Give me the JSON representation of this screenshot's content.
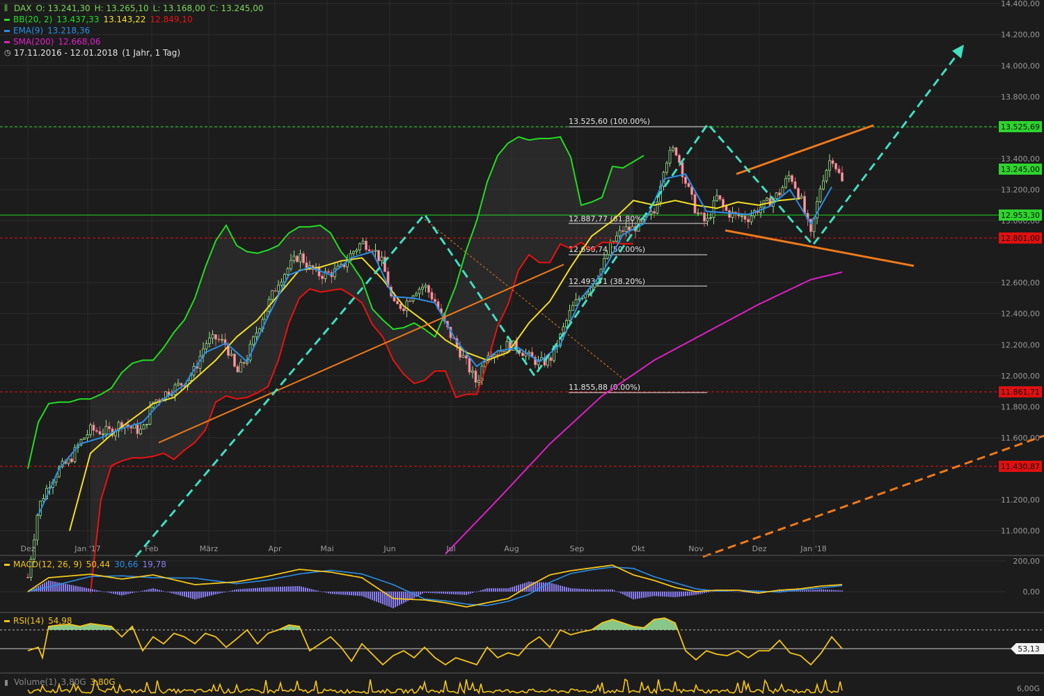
{
  "legend": {
    "dax": {
      "name": "DAX",
      "o": "O: 13.241,30",
      "h": "H: 13.265,10",
      "l": "L: 13.168,00",
      "c": "C: 13.245,00",
      "color": "#7ed957"
    },
    "bb": {
      "name": "BB(20, 2)",
      "upper": "13.437,33",
      "mid": "13.143,22",
      "lower": "12.849,10",
      "colors": {
        "upper": "#22dd22",
        "mid": "#f5e024",
        "lower": "#ee1111"
      }
    },
    "ema": {
      "name": "EMA(9)",
      "value": "13.218,36",
      "color": "#2a8fe8"
    },
    "sma": {
      "name": "SMA(200)",
      "value": "12.668,06",
      "color": "#e020c8"
    },
    "range": "17.11.2016 - 12.01.2018",
    "period": "(1 Jahr, 1 Tag)"
  },
  "macd": {
    "label": "MACD(12, 26, 9)",
    "v1": "50,44",
    "v2": "30,66",
    "v3": "19,78"
  },
  "rsi": {
    "label": "RSI(14)",
    "value": "54,98",
    "marker": "53,13"
  },
  "volume": {
    "label": "Volume(1)",
    "v1": "3,80G",
    "v2": "3,80G",
    "axis_top": "6,00G"
  },
  "chart_data": {
    "type": "candlestick",
    "title": "DAX",
    "x_tick_labels": [
      "Dez",
      "Jan '17",
      "Feb",
      "März",
      "Apr",
      "Mai",
      "Jun",
      "Jul",
      "Aug",
      "Sep",
      "Okt",
      "Nov",
      "Dez",
      "Jan '18"
    ],
    "y_range": [
      10850,
      14450
    ],
    "y_tick_labels": [
      "11.000,00",
      "11.200,00",
      "11.600,00",
      "11.800,00",
      "12.000,00",
      "12.200,00",
      "12.400,00",
      "12.600,00",
      "13.000,00",
      "13.200,00",
      "13.400,00",
      "13.600,00",
      "13.800,00",
      "14.000,00",
      "14.200,00",
      "14.400,00"
    ],
    "price_path": [
      [
        0,
        10700
      ],
      [
        10,
        11150
      ],
      [
        20,
        11300
      ],
      [
        30,
        11400
      ],
      [
        40,
        11450
      ],
      [
        50,
        11570
      ],
      [
        60,
        11650
      ],
      [
        70,
        11640
      ],
      [
        80,
        11640
      ],
      [
        90,
        11700
      ],
      [
        100,
        11660
      ],
      [
        110,
        11640
      ],
      [
        120,
        11830
      ],
      [
        130,
        11880
      ],
      [
        140,
        11920
      ],
      [
        150,
        11960
      ],
      [
        160,
        12040
      ],
      [
        170,
        12210
      ],
      [
        180,
        12240
      ],
      [
        190,
        12200
      ],
      [
        200,
        12010
      ],
      [
        210,
        12120
      ],
      [
        220,
        12300
      ],
      [
        230,
        12460
      ],
      [
        240,
        12610
      ],
      [
        250,
        12700
      ],
      [
        260,
        12780
      ],
      [
        270,
        12690
      ],
      [
        280,
        12650
      ],
      [
        290,
        12660
      ],
      [
        300,
        12690
      ],
      [
        310,
        12790
      ],
      [
        320,
        12860
      ],
      [
        330,
        12830
      ],
      [
        340,
        12720
      ],
      [
        350,
        12450
      ],
      [
        360,
        12450
      ],
      [
        370,
        12550
      ],
      [
        380,
        12580
      ],
      [
        390,
        12480
      ],
      [
        400,
        12320
      ],
      [
        410,
        12200
      ],
      [
        420,
        12080
      ],
      [
        430,
        11950
      ],
      [
        440,
        12160
      ],
      [
        450,
        12150
      ],
      [
        460,
        12200
      ],
      [
        470,
        12180
      ],
      [
        480,
        12120
      ],
      [
        490,
        12080
      ],
      [
        500,
        12100
      ],
      [
        510,
        12250
      ],
      [
        520,
        12420
      ],
      [
        530,
        12520
      ],
      [
        540,
        12580
      ],
      [
        550,
        12700
      ],
      [
        560,
        12860
      ],
      [
        570,
        12940
      ],
      [
        580,
        12950
      ],
      [
        590,
        13000
      ],
      [
        600,
        13050
      ],
      [
        610,
        13380
      ],
      [
        620,
        13470
      ],
      [
        630,
        13250
      ],
      [
        640,
        13060
      ],
      [
        650,
        12980
      ],
      [
        660,
        13150
      ],
      [
        670,
        13050
      ],
      [
        680,
        13030
      ],
      [
        690,
        13020
      ],
      [
        700,
        13080
      ],
      [
        710,
        13120
      ],
      [
        720,
        13180
      ],
      [
        730,
        13300
      ],
      [
        740,
        13150
      ],
      [
        750,
        12900
      ],
      [
        760,
        13250
      ],
      [
        770,
        13420
      ],
      [
        780,
        13245
      ]
    ],
    "bb_upper_path": [
      [
        0,
        11400
      ],
      [
        10,
        11700
      ],
      [
        20,
        11820
      ],
      [
        30,
        11830
      ],
      [
        40,
        11830
      ],
      [
        50,
        11850
      ],
      [
        60,
        11850
      ],
      [
        70,
        11880
      ],
      [
        80,
        11920
      ],
      [
        90,
        12020
      ],
      [
        100,
        12080
      ],
      [
        110,
        12100
      ],
      [
        120,
        12100
      ],
      [
        130,
        12180
      ],
      [
        140,
        12280
      ],
      [
        150,
        12360
      ],
      [
        160,
        12500
      ],
      [
        170,
        12700
      ],
      [
        180,
        12870
      ],
      [
        190,
        12970
      ],
      [
        200,
        12840
      ],
      [
        210,
        12800
      ],
      [
        220,
        12790
      ],
      [
        230,
        12810
      ],
      [
        240,
        12840
      ],
      [
        250,
        12920
      ],
      [
        260,
        12960
      ],
      [
        270,
        12960
      ],
      [
        280,
        12970
      ],
      [
        290,
        12920
      ],
      [
        300,
        12800
      ],
      [
        310,
        12720
      ],
      [
        320,
        12620
      ],
      [
        330,
        12430
      ],
      [
        340,
        12360
      ],
      [
        350,
        12300
      ],
      [
        360,
        12310
      ],
      [
        370,
        12340
      ],
      [
        380,
        12300
      ],
      [
        390,
        12250
      ],
      [
        400,
        12410
      ],
      [
        410,
        12580
      ],
      [
        420,
        12810
      ],
      [
        430,
        13000
      ],
      [
        440,
        13250
      ],
      [
        450,
        13420
      ],
      [
        460,
        13500
      ],
      [
        470,
        13540
      ],
      [
        480,
        13520
      ],
      [
        490,
        13530
      ],
      [
        500,
        13530
      ],
      [
        510,
        13540
      ],
      [
        520,
        13410
      ],
      [
        530,
        13100
      ],
      [
        540,
        13120
      ],
      [
        550,
        13150
      ],
      [
        560,
        13350
      ],
      [
        570,
        13340
      ],
      [
        580,
        13380
      ],
      [
        590,
        13420
      ]
    ],
    "bb_lower_path": [
      [
        60,
        10600
      ],
      [
        70,
        11200
      ],
      [
        80,
        11420
      ],
      [
        90,
        11450
      ],
      [
        100,
        11470
      ],
      [
        110,
        11470
      ],
      [
        120,
        11480
      ],
      [
        130,
        11500
      ],
      [
        140,
        11460
      ],
      [
        150,
        11520
      ],
      [
        160,
        11570
      ],
      [
        170,
        11650
      ],
      [
        180,
        11830
      ],
      [
        190,
        11870
      ],
      [
        200,
        11850
      ],
      [
        210,
        11860
      ],
      [
        220,
        11890
      ],
      [
        230,
        11930
      ],
      [
        240,
        12100
      ],
      [
        250,
        12340
      ],
      [
        260,
        12500
      ],
      [
        270,
        12560
      ],
      [
        280,
        12540
      ],
      [
        290,
        12550
      ],
      [
        300,
        12560
      ],
      [
        310,
        12520
      ],
      [
        320,
        12470
      ],
      [
        330,
        12330
      ],
      [
        340,
        12250
      ],
      [
        350,
        12100
      ],
      [
        360,
        12010
      ],
      [
        370,
        11950
      ],
      [
        380,
        11970
      ],
      [
        390,
        12030
      ],
      [
        400,
        12030
      ],
      [
        410,
        11860
      ],
      [
        420,
        11880
      ],
      [
        430,
        11880
      ],
      [
        440,
        12080
      ],
      [
        450,
        12320
      ],
      [
        460,
        12460
      ],
      [
        470,
        12680
      ],
      [
        480,
        12780
      ],
      [
        490,
        12730
      ],
      [
        500,
        12730
      ],
      [
        510,
        12850
      ],
      [
        520,
        12820
      ],
      [
        530,
        12860
      ],
      [
        540,
        12810
      ],
      [
        550,
        12860
      ],
      [
        560,
        12860
      ],
      [
        570,
        12850
      ],
      [
        580,
        12850
      ]
    ],
    "bb_mid_path": [
      [
        40,
        11000
      ],
      [
        60,
        11500
      ],
      [
        80,
        11620
      ],
      [
        100,
        11720
      ],
      [
        120,
        11820
      ],
      [
        140,
        11860
      ],
      [
        160,
        11980
      ],
      [
        180,
        12100
      ],
      [
        200,
        12250
      ],
      [
        220,
        12360
      ],
      [
        240,
        12520
      ],
      [
        260,
        12680
      ],
      [
        280,
        12700
      ],
      [
        300,
        12740
      ],
      [
        320,
        12760
      ],
      [
        340,
        12620
      ],
      [
        360,
        12450
      ],
      [
        380,
        12350
      ],
      [
        400,
        12230
      ],
      [
        420,
        12150
      ],
      [
        440,
        12100
      ],
      [
        460,
        12150
      ],
      [
        480,
        12340
      ],
      [
        500,
        12480
      ],
      [
        520,
        12700
      ],
      [
        540,
        12900
      ],
      [
        560,
        13000
      ],
      [
        580,
        13130
      ],
      [
        600,
        13100
      ],
      [
        620,
        13130
      ],
      [
        640,
        13100
      ],
      [
        660,
        13080
      ],
      [
        680,
        13120
      ],
      [
        700,
        13100
      ],
      [
        720,
        13130
      ],
      [
        740,
        13143
      ]
    ],
    "ema_path": [
      [
        10,
        11100
      ],
      [
        30,
        11400
      ],
      [
        50,
        11560
      ],
      [
        70,
        11600
      ],
      [
        90,
        11660
      ],
      [
        110,
        11700
      ],
      [
        130,
        11850
      ],
      [
        150,
        11940
      ],
      [
        170,
        12150
      ],
      [
        190,
        12210
      ],
      [
        210,
        12090
      ],
      [
        230,
        12380
      ],
      [
        250,
        12650
      ],
      [
        270,
        12700
      ],
      [
        290,
        12650
      ],
      [
        310,
        12760
      ],
      [
        330,
        12800
      ],
      [
        350,
        12510
      ],
      [
        370,
        12500
      ],
      [
        390,
        12470
      ],
      [
        410,
        12230
      ],
      [
        430,
        12060
      ],
      [
        450,
        12160
      ],
      [
        470,
        12180
      ],
      [
        490,
        12090
      ],
      [
        510,
        12200
      ],
      [
        530,
        12500
      ],
      [
        550,
        12660
      ],
      [
        570,
        12910
      ],
      [
        590,
        12980
      ],
      [
        610,
        13270
      ],
      [
        630,
        13300
      ],
      [
        650,
        13060
      ],
      [
        670,
        13050
      ],
      [
        690,
        13040
      ],
      [
        710,
        13090
      ],
      [
        730,
        13200
      ],
      [
        750,
        12980
      ],
      [
        770,
        13218
      ]
    ],
    "sma200_path": [
      [
        400,
        10850
      ],
      [
        450,
        11200
      ],
      [
        500,
        11560
      ],
      [
        550,
        11870
      ],
      [
        600,
        12100
      ],
      [
        650,
        12280
      ],
      [
        700,
        12460
      ],
      [
        750,
        12620
      ],
      [
        780,
        12668
      ]
    ],
    "horizontal_levels": [
      {
        "value": "13.525,69",
        "color": "#22dd22",
        "style": "dashed"
      },
      {
        "value": "13.245,00",
        "color": "#22dd22",
        "style": "label"
      },
      {
        "value": "12.953,30",
        "color": "#22dd22",
        "style": "solid"
      },
      {
        "value": "12.801,00",
        "color": "#ee1111",
        "style": "dashed"
      },
      {
        "value": "11.861,71",
        "color": "#ee1111",
        "style": "dashed"
      },
      {
        "value": "11.430,87",
        "color": "#ee1111",
        "style": "dashed"
      }
    ],
    "fibonacci": [
      {
        "label": "13.525,60 (100.00%)"
      },
      {
        "label": "12.887,77 (61.80%)"
      },
      {
        "label": "12.690,74 (50.00%)"
      },
      {
        "label": "12.493,71 (38.20%)"
      },
      {
        "label": "11.855,88 (0.00%)"
      }
    ],
    "macd_axis": [
      "200,00",
      "0,00"
    ],
    "grid": true
  }
}
